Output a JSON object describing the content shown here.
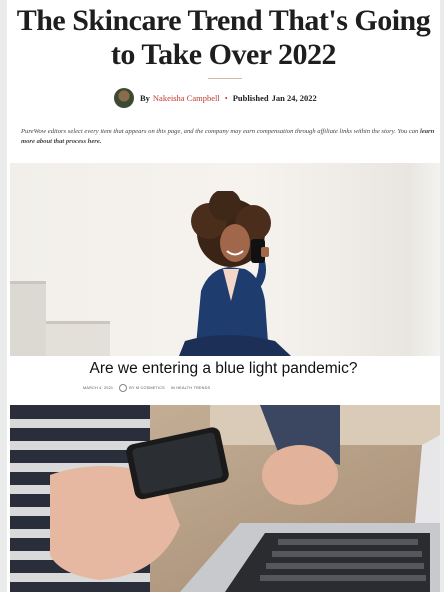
{
  "article": {
    "headline": "The Skincare Trend That's Going to Take Over 2022",
    "byline": {
      "by": "By",
      "author": "Nakeisha Campbell",
      "separator": "•",
      "published_label": "Published",
      "date": "Jan 24, 2022"
    },
    "disclosure": {
      "text": "PureWow editors select every item that appears on this page, and the company may earn compensation through affiliate links within the story. You can ",
      "link": "learn more about that process here.",
      "link_color": "#111111"
    }
  },
  "card": {
    "title": "Are we entering a blue light pandemic?",
    "meta": {
      "date": "MARCH 4, 2021",
      "author": "BY M COSMETICS",
      "category": "IN HEALTH TRENDS"
    }
  },
  "colors": {
    "accent": "#c0392b",
    "rule": "#d8b9ae",
    "background": "#e9ecea"
  },
  "images": {
    "hero": "woman-with-curly-hair-taking-selfie",
    "second": "hands-holding-phone-over-laptop"
  }
}
